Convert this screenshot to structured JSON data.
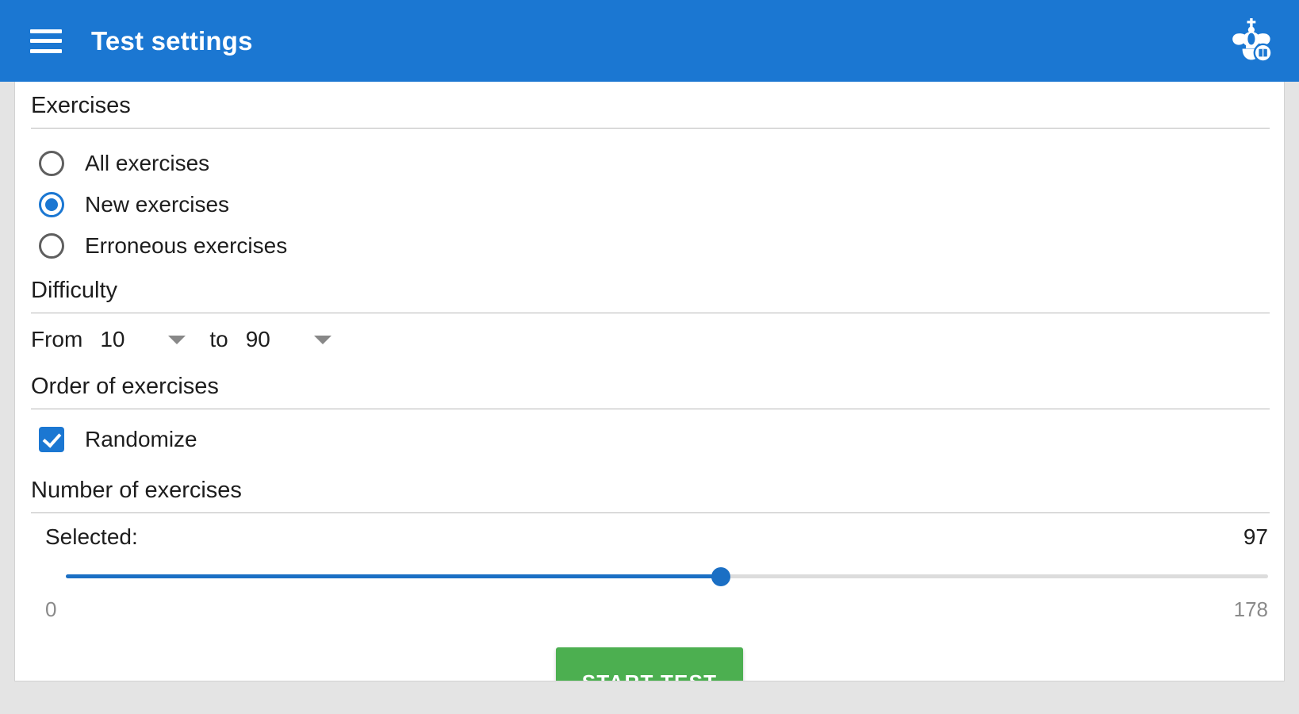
{
  "appbar": {
    "menu_icon": "hamburger-menu-icon",
    "title": "Test settings",
    "logo_icon": "chess-king-book-logo",
    "background_color": "#1b77d2",
    "text_color": "#ffffff"
  },
  "sections": {
    "exercises": {
      "heading": "Exercises",
      "options": [
        {
          "label": "All exercises",
          "selected": false
        },
        {
          "label": "New exercises",
          "selected": true
        },
        {
          "label": "Erroneous exercises",
          "selected": false
        }
      ]
    },
    "difficulty": {
      "heading": "Difficulty",
      "from_label": "From",
      "from_value": "10",
      "to_label": "to",
      "to_value": "90",
      "caret_icon": "chevron-down-icon"
    },
    "order": {
      "heading": "Order of exercises",
      "randomize_label": "Randomize",
      "randomize_checked": true
    },
    "number": {
      "heading": "Number of exercises",
      "selected_label": "Selected:",
      "selected_value": "97",
      "min_label": "0",
      "max_label": "178",
      "slider": {
        "min": 0,
        "max": 178,
        "value": 97,
        "fill_color": "#1b6fc4",
        "track_color": "#dcdcdc"
      }
    }
  },
  "actions": {
    "start_label": "START TEST",
    "start_color": "#4caf50"
  }
}
